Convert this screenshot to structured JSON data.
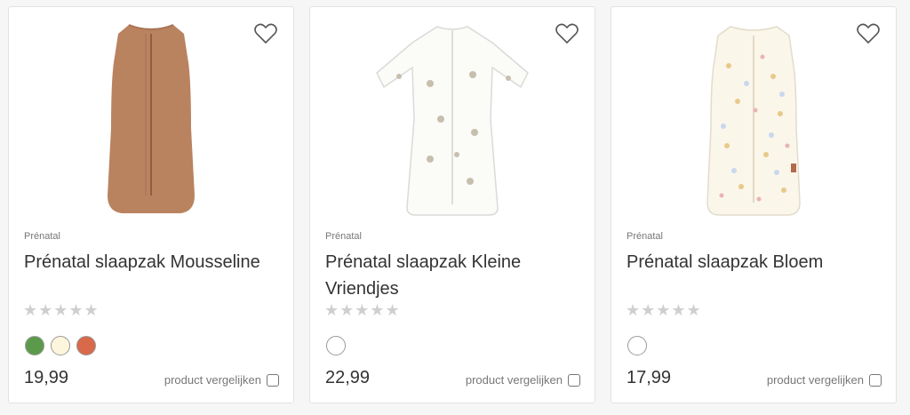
{
  "products": [
    {
      "brand": "Prénatal",
      "title": "Prénatal slaapzak Mousseline",
      "rating_stars": "★★★★★",
      "price": "19,99",
      "compare_label": "product vergelijken",
      "image": "sleeping-bag-sleeveless-brown",
      "swatches": [
        "#5b9a4b",
        "#fdf6dc",
        "#d8694a"
      ]
    },
    {
      "brand": "Prénatal",
      "title": "Prénatal slaapzak Kleine Vriendjes",
      "rating_stars": "★★★★★",
      "price": "22,99",
      "compare_label": "product vergelijken",
      "image": "sleeping-bag-long-sleeve-white",
      "swatches": [
        "#ffffff"
      ]
    },
    {
      "brand": "Prénatal",
      "title": "Prénatal slaapzak Bloem",
      "rating_stars": "★★★★★",
      "price": "17,99",
      "compare_label": "product vergelijken",
      "image": "sleeping-bag-sleeveless-floral",
      "swatches": [
        "#ffffff"
      ]
    }
  ],
  "icons": {
    "wishlist": "heart-outline-icon",
    "compare": "checkbox-icon"
  },
  "colors": {
    "text_primary": "#333333",
    "text_secondary": "#777777",
    "star_empty": "#cfcfcf",
    "border": "#e2e2e2"
  }
}
